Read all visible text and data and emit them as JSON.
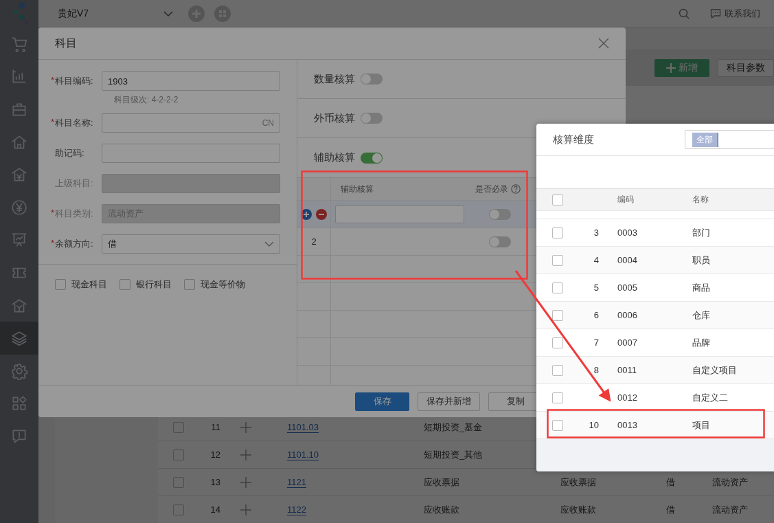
{
  "app": {
    "brand": "贵妃V7",
    "contact": "联系我们",
    "sidebar": {
      "items": [
        {
          "selected": false
        },
        {
          "selected": false
        },
        {
          "selected": false
        },
        {
          "selected": false
        },
        {
          "selected": false
        },
        {
          "selected": false
        },
        {
          "selected": false
        },
        {
          "selected": false
        },
        {
          "selected": false
        },
        {
          "selected": true
        },
        {
          "selected": false
        },
        {
          "selected": false
        },
        {
          "selected": false
        }
      ]
    },
    "toolbar_buttons": [
      {
        "label": "新增",
        "kind": "primary"
      },
      {
        "label": "科目参数",
        "kind": "default"
      }
    ],
    "table": {
      "rows": [
        {
          "no": "11",
          "code": "1101.03",
          "name": "短期投资_基金",
          "checked": false
        },
        {
          "no": "12",
          "code": "1101.10",
          "name": "短期投资_其他",
          "checked": false
        },
        {
          "no": "13",
          "code": "1121",
          "name": "应收票据",
          "column_5": "应收票据",
          "column_6": "借",
          "column_7": "流动资产",
          "checked": false
        },
        {
          "no": "14",
          "code": "1122",
          "name": "应收账款",
          "column_5": "应收账款",
          "column_6": "借",
          "column_7": "流动资产",
          "checked": false
        }
      ]
    }
  },
  "dialog": {
    "title": "科目",
    "fields": [
      {
        "mark": "*",
        "label": "科目编码:",
        "kind": "text",
        "value": "1903",
        "hint": "科目级次: 4-2-2-2",
        "disabled": false
      },
      {
        "mark": "*",
        "label": "科目名称:",
        "kind": "text",
        "suffix": "CN",
        "disabled": false
      },
      {
        "label": "助记码:",
        "kind": "text",
        "disabled": false
      },
      {
        "label": "上级科目:",
        "kind": "text",
        "disabled": true
      },
      {
        "mark": "*",
        "label": "科目类别:",
        "kind": "text",
        "value": "流动资产",
        "disabled": true
      },
      {
        "mark": "*",
        "label": "余额方向:",
        "kind": "select",
        "value": "借",
        "disabled": false
      }
    ],
    "checkboxes": [
      {
        "label": "现金科目",
        "checked": false
      },
      {
        "label": "银行科目",
        "checked": false
      },
      {
        "label": "现金等价物",
        "checked": false
      }
    ],
    "switches": [
      {
        "label": "数量核算",
        "on": false
      },
      {
        "label": "外币核算",
        "on": false
      },
      {
        "label": "辅助核算",
        "on": true
      }
    ],
    "aux_table": {
      "columns": [
        "辅助核算",
        "是否必录"
      ],
      "rows": [
        {
          "kind": "edit",
          "on": false
        },
        {
          "kind": "plain",
          "no": "2",
          "on": false
        }
      ]
    },
    "buttons": [
      {
        "label": "保存",
        "kind": "primary"
      },
      {
        "label": "保存并新增",
        "kind": "default"
      },
      {
        "label": "复制",
        "kind": "default"
      }
    ]
  },
  "popup": {
    "title": "核算维度",
    "filter_tag": "全部",
    "all_checked": false,
    "columns": [
      "编码",
      "名称"
    ],
    "rows": [
      {
        "no": "3",
        "code": "0003",
        "name": "部门",
        "checked": false
      },
      {
        "no": "4",
        "code": "0004",
        "name": "职员",
        "checked": false
      },
      {
        "no": "5",
        "code": "0005",
        "name": "商品",
        "checked": false
      },
      {
        "no": "6",
        "code": "0006",
        "name": "仓库",
        "checked": false
      },
      {
        "no": "7",
        "code": "0007",
        "name": "品牌",
        "checked": false
      },
      {
        "no": "8",
        "code": "0011",
        "name": "自定义项目",
        "checked": false
      },
      {
        "code": "0012",
        "name": "自定义二",
        "checked": false
      },
      {
        "no": "10",
        "code": "0013",
        "name": "项目",
        "checked": false
      }
    ]
  }
}
